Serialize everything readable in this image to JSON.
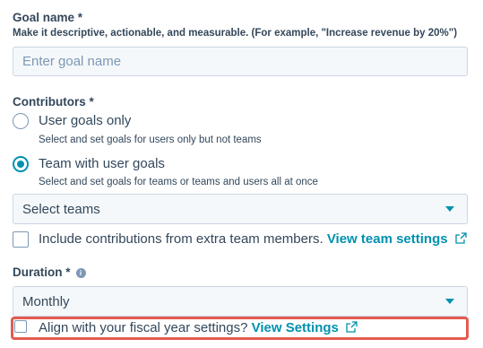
{
  "goal_name": {
    "label": "Goal name *",
    "helper": "Make it descriptive, actionable, and measurable. (For example, \"Increase revenue by 20%\")",
    "placeholder": "Enter goal name"
  },
  "contributors": {
    "label": "Contributors *",
    "options": [
      {
        "label": "User goals only",
        "description": "Select and set goals for users only but not teams",
        "selected": false
      },
      {
        "label": "Team with user goals",
        "description": "Select and set goals for teams or teams and users all at once",
        "selected": true
      }
    ],
    "teams_select": {
      "value": "Select teams"
    },
    "extra_members": {
      "label": "Include contributions from extra team members.",
      "link": "View team settings",
      "checked": false
    }
  },
  "duration": {
    "label": "Duration *",
    "info_icon": "info-icon",
    "select": {
      "value": "Monthly"
    },
    "fiscal": {
      "label": "Align with your fiscal year settings?",
      "link": "View Settings",
      "checked": false
    }
  },
  "colors": {
    "accent": "#0091ae",
    "text": "#33475b",
    "highlight": "#e45b4f"
  }
}
